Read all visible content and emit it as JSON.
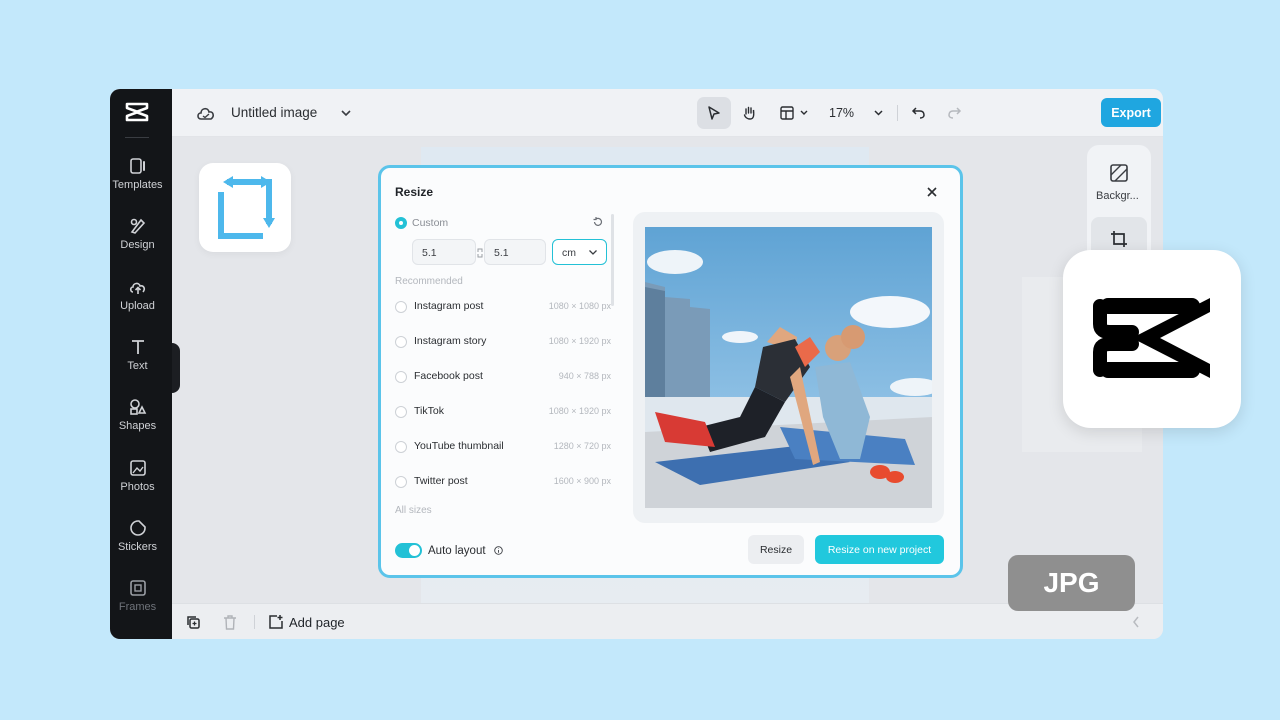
{
  "header": {
    "title": "Untitled image",
    "zoom": "17%",
    "export_label": "Export"
  },
  "sidebar": {
    "items": [
      {
        "label": "Templates"
      },
      {
        "label": "Design"
      },
      {
        "label": "Upload"
      },
      {
        "label": "Text"
      },
      {
        "label": "Shapes"
      },
      {
        "label": "Photos"
      },
      {
        "label": "Stickers"
      },
      {
        "label": "Frames"
      }
    ]
  },
  "right_panel": {
    "background_label": "Backgr..."
  },
  "bottombar": {
    "add_page_label": "Add page"
  },
  "resize_dialog": {
    "title": "Resize",
    "custom_label": "Custom",
    "width_value": "5.1",
    "height_value": "5.1",
    "unit": "cm",
    "recommended_label": "Recommended",
    "sizes": [
      {
        "name": "Instagram post",
        "dims": "1080 × 1080 px"
      },
      {
        "name": "Instagram story",
        "dims": "1080 × 1920 px"
      },
      {
        "name": "Facebook post",
        "dims": "940 × 788 px"
      },
      {
        "name": "TikTok",
        "dims": "1080 × 1920 px"
      },
      {
        "name": "YouTube thumbnail",
        "dims": "1280 × 720 px"
      },
      {
        "name": "Twitter post",
        "dims": "1600 × 900 px"
      }
    ],
    "all_sizes_label": "All sizes",
    "auto_layout_label": "Auto layout",
    "auto_layout_on": true,
    "resize_button": "Resize",
    "resize_new_button": "Resize on new project"
  },
  "badges": {
    "format": "JPG"
  },
  "colors": {
    "accent": "#21c8dd",
    "export": "#1fa6e0",
    "background": "#c3e8fb",
    "sidebar": "#131518"
  }
}
